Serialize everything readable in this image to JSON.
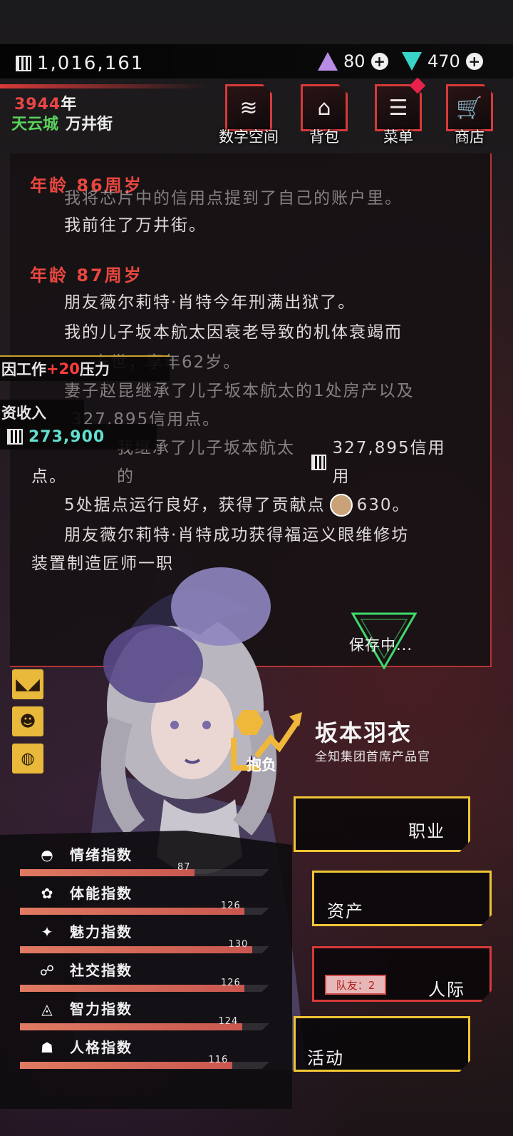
{
  "header": {
    "credits": "1,016,161",
    "currency_a": "80",
    "currency_b": "470",
    "year": "3944",
    "year_suffix": "年",
    "city": "天云城",
    "street": "万井街"
  },
  "nav": {
    "digital_space": "数字空间",
    "backpack": "背包",
    "menu": "菜单",
    "shop": "商店"
  },
  "story": {
    "age1": "年龄 86周岁",
    "line_cut": "我将芯片中的信用点提到了自己的账户里。",
    "line_a": "我前往了万井街。",
    "age2": "年龄 87周岁",
    "line_b": "朋友薇尔莉特·肖特今年刑满出狱了。",
    "line_c": "我的儿子坂本航太因衰老导致的机体衰竭而",
    "line_c2": "去世，享年62岁。",
    "line_d": "妻子赵昆继承了儿子坂本航太的1处房产以及",
    "line_d2": "327,895信用点。",
    "line_e1": "我继承了儿子坂本航太的",
    "line_e2": "327,895信用用",
    "line_e3": "点。",
    "line_f1": "5处据点运行良好，获得了贡献点",
    "line_f2": "630。",
    "line_g": "朋友薇尔莉特·肖特成功获得福运义眼维修坊",
    "line_g2": "装置制造匠师一职"
  },
  "notifications": {
    "pressure_pre": "因工作",
    "pressure_val": "+20",
    "pressure_post": "压力",
    "income_label": "资收入",
    "income_value": "273,900"
  },
  "status": {
    "saving": "保存中..."
  },
  "character": {
    "ambition_label": "抱负",
    "name": "坂本羽衣",
    "title": "全知集团首席产品官"
  },
  "actions": {
    "career": "职业",
    "assets": "资产",
    "social": "人际",
    "teammates": "队友：2",
    "activity": "活动"
  },
  "stats": [
    {
      "name": "情绪指数",
      "value": "87",
      "fraction": 0.7
    },
    {
      "name": "体能指数",
      "value": "126",
      "fraction": 0.9
    },
    {
      "name": "魅力指数",
      "value": "130",
      "fraction": 0.93
    },
    {
      "name": "社交指数",
      "value": "126",
      "fraction": 0.9
    },
    {
      "name": "智力指数",
      "value": "124",
      "fraction": 0.89
    },
    {
      "name": "人格指数",
      "value": "116",
      "fraction": 0.85
    }
  ]
}
